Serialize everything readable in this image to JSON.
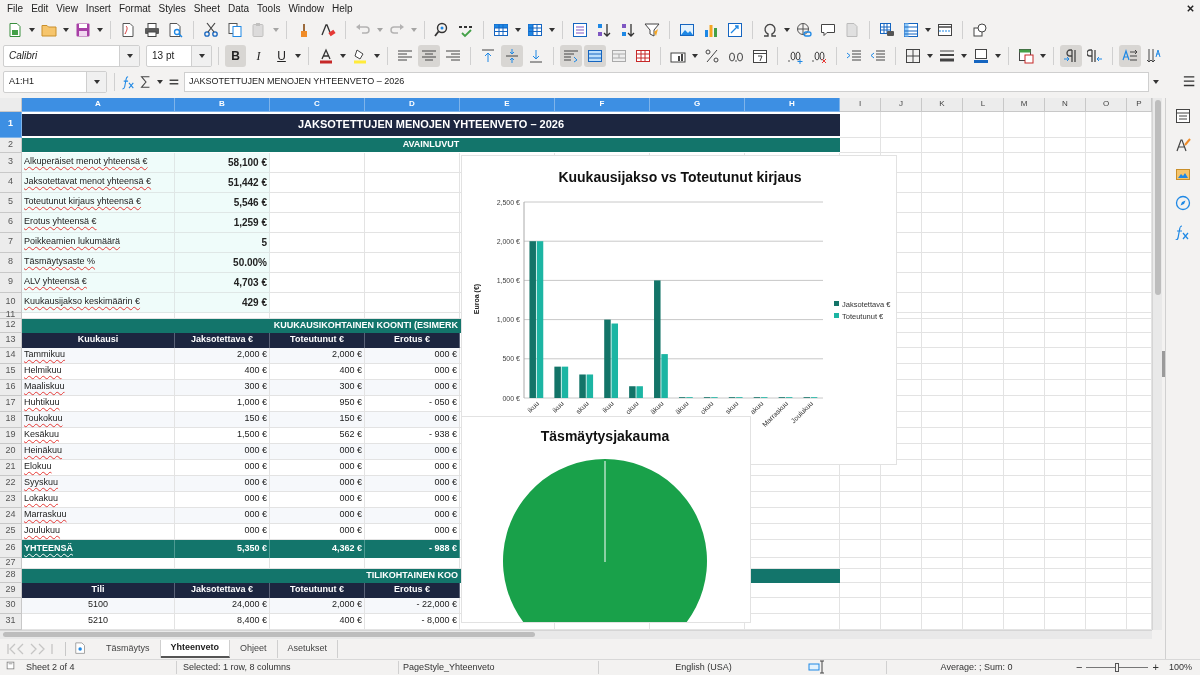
{
  "menu_bar": [
    "File",
    "Edit",
    "View",
    "Insert",
    "Format",
    "Styles",
    "Sheet",
    "Data",
    "Tools",
    "Window",
    "Help"
  ],
  "standard_toolbar": {
    "paste": {
      "disabled": true
    },
    "undo": {
      "disabled": true
    },
    "redo": {
      "disabled": true
    }
  },
  "format_toolbar": {
    "font_name": "Calibri",
    "font_size": "13 pt",
    "toggles": [
      {
        "kind": "bold",
        "label": "B",
        "on": true
      },
      {
        "kind": "italic",
        "label": "I",
        "on": false
      },
      {
        "kind": "underline",
        "label": "U",
        "on": false
      }
    ],
    "horizontal_align": [
      {
        "kind": "left",
        "selected": false
      },
      {
        "kind": "center",
        "selected": true
      },
      {
        "kind": "right",
        "selected": false
      }
    ],
    "vertical_align": [
      {
        "kind": "top",
        "selected": false
      },
      {
        "kind": "center",
        "selected": true
      },
      {
        "kind": "bottom",
        "selected": false
      }
    ],
    "wrap_text": {
      "on": true
    },
    "merge_and_center": {
      "on": true
    },
    "paragraph_direction": [
      {
        "kind": "ltr",
        "selected": true
      },
      {
        "kind": "rtl",
        "selected": false
      }
    ],
    "text_direction": [
      {
        "kind": "horizontal",
        "selected": true
      },
      {
        "kind": "vertical",
        "selected": false
      }
    ]
  },
  "formula_bar": {
    "name_box": "A1:H1",
    "content": "JAKSOTETTUJEN MENOJEN YHTEENVETO – 2026"
  },
  "columns": [
    {
      "label": "A",
      "selected": true
    },
    {
      "label": "B",
      "selected": true
    },
    {
      "label": "C",
      "selected": true
    },
    {
      "label": "D",
      "selected": true
    },
    {
      "label": "E",
      "selected": true
    },
    {
      "label": "F",
      "selected": true
    },
    {
      "label": "G",
      "selected": true
    },
    {
      "label": "H",
      "selected": true
    },
    {
      "label": "I",
      "selected": false
    },
    {
      "label": "J",
      "selected": false
    },
    {
      "label": "K",
      "selected": false
    },
    {
      "label": "L",
      "selected": false
    },
    {
      "label": "M",
      "selected": false
    },
    {
      "label": "N",
      "selected": false
    },
    {
      "label": "O",
      "selected": false
    },
    {
      "label": "P",
      "selected": false
    }
  ],
  "rows": [
    {
      "label": "1",
      "selected": true
    },
    {
      "label": "2",
      "selected": false
    },
    {
      "label": "3",
      "selected": false
    },
    {
      "label": "4",
      "selected": false
    },
    {
      "label": "5",
      "selected": false
    },
    {
      "label": "6",
      "selected": false
    },
    {
      "label": "7",
      "selected": false
    },
    {
      "label": "8",
      "selected": false
    },
    {
      "label": "9",
      "selected": false
    },
    {
      "label": "10",
      "selected": false
    },
    {
      "label": "11",
      "selected": false
    },
    {
      "label": "12",
      "selected": false
    },
    {
      "label": "13",
      "selected": false
    },
    {
      "label": "14",
      "selected": false
    },
    {
      "label": "15",
      "selected": false
    },
    {
      "label": "16",
      "selected": false
    },
    {
      "label": "17",
      "selected": false
    },
    {
      "label": "18",
      "selected": false
    },
    {
      "label": "19",
      "selected": false
    },
    {
      "label": "20",
      "selected": false
    },
    {
      "label": "21",
      "selected": false
    },
    {
      "label": "22",
      "selected": false
    },
    {
      "label": "23",
      "selected": false
    },
    {
      "label": "24",
      "selected": false
    },
    {
      "label": "25",
      "selected": false
    },
    {
      "label": "26",
      "selected": false
    },
    {
      "label": "27",
      "selected": false
    },
    {
      "label": "28",
      "selected": false
    },
    {
      "label": "29",
      "selected": false
    },
    {
      "label": "30",
      "selected": false
    },
    {
      "label": "31",
      "selected": false
    }
  ],
  "sheet": {
    "title": "JAKSOTETTUJEN MENOJEN YHTEENVETO – 2026",
    "key_figures_heading": "AVAINLUVUT",
    "key_figures": [
      {
        "label": "Alkuperäiset menot yhteensä €",
        "value": "58,100 €"
      },
      {
        "label": "Jaksotettavat menot yhteensä €",
        "value": "51,442 €"
      },
      {
        "label": "Toteutunut kirjaus yhteensä €",
        "value": "5,546 €"
      },
      {
        "label": "Erotus yhteensä €",
        "value": "1,259 €"
      },
      {
        "label": "Poikkeamien lukumäärä",
        "value": "5"
      },
      {
        "label": "Täsmäytysaste %",
        "value": "50.00%"
      },
      {
        "label": "ALV yhteensä €",
        "value": "4,703 €"
      },
      {
        "label": "Kuukausijakso keskimäärin €",
        "value": "429 €"
      }
    ],
    "monthly_heading": "KUUKAUSIKOHTAINEN KOONTI (ESIMERK",
    "monthly_columns": [
      "Kuukausi",
      "Jaksotettava €",
      "Toteutunut €",
      "Erotus €"
    ],
    "monthly_rows": [
      [
        "Tammikuu",
        "2,000 €",
        "2,000 €",
        "000 €"
      ],
      [
        "Helmikuu",
        "400 €",
        "400 €",
        "000 €"
      ],
      [
        "Maaliskuu",
        "300 €",
        "300 €",
        "000 €"
      ],
      [
        "Huhtikuu",
        "1,000 €",
        "950 €",
        "- 050 €"
      ],
      [
        "Toukokuu",
        "150 €",
        "150 €",
        "000 €"
      ],
      [
        "Kesäkuu",
        "1,500 €",
        "562 €",
        "- 938 €"
      ],
      [
        "Heinäkuu",
        "000 €",
        "000 €",
        "000 €"
      ],
      [
        "Elokuu",
        "000 €",
        "000 €",
        "000 €"
      ],
      [
        "Syyskuu",
        "000 €",
        "000 €",
        "000 €"
      ],
      [
        "Lokakuu",
        "000 €",
        "000 €",
        "000 €"
      ],
      [
        "Marraskuu",
        "000 €",
        "000 €",
        "000 €"
      ],
      [
        "Joulukuu",
        "000 €",
        "000 €",
        "000 €"
      ]
    ],
    "monthly_total": [
      "YHTEENSÄ",
      "5,350 €",
      "4,362 €",
      "- 988 €"
    ],
    "account_heading": "TILIKOHTAINEN KOO",
    "account_columns": [
      "Tili",
      "Jaksotettava €",
      "Toteutunut €",
      "Erotus €"
    ],
    "account_rows": [
      [
        "5100",
        "24,000 €",
        "2,000 €",
        "- 22,000 €"
      ],
      [
        "5210",
        "8,400 €",
        "400 €",
        "- 8,000 €"
      ]
    ]
  },
  "bar_chart": {
    "chart_data": {
      "type": "bar",
      "title": "Kuukausijakso vs Toteutunut kirjaus",
      "ylabel": "Euroa (€)",
      "categories": [
        "ikuu",
        "ikuu",
        "skuu",
        "ikuu",
        "okuu",
        "äkuu",
        "äkuu",
        "okuu",
        "skuu",
        "akuu",
        "Marraskuu",
        "Joulukuu"
      ],
      "series": [
        {
          "name": "Jaksotettava €",
          "color": "#137468",
          "values": [
            2000,
            400,
            300,
            1000,
            150,
            1500,
            0,
            0,
            0,
            0,
            0,
            0
          ]
        },
        {
          "name": "Toteutunut €",
          "color": "#1cb5a3",
          "values": [
            2000,
            400,
            300,
            950,
            150,
            560,
            0,
            0,
            0,
            0,
            0,
            0
          ]
        }
      ],
      "grid": true,
      "legend": true,
      "ylim": [
        0,
        2500
      ],
      "yticks": [
        {
          "value": 0,
          "label": "000 €"
        },
        {
          "value": 500,
          "label": "500 €"
        },
        {
          "value": 1000,
          "label": "1,000 €"
        },
        {
          "value": 1500,
          "label": "1,500 €"
        },
        {
          "value": 2000,
          "label": "2,000 €"
        },
        {
          "value": 2500,
          "label": "2,500 €"
        }
      ]
    }
  },
  "pie_chart": {
    "title": "Täsmäytysjakauma"
  },
  "sheet_navigation": {
    "disabled": true
  },
  "sheet_tabs": [
    {
      "label": "Täsmäytys",
      "selected": false
    },
    {
      "label": "Yhteenveto",
      "selected": true
    },
    {
      "label": "Ohjeet",
      "selected": false
    },
    {
      "label": "Asetukset",
      "selected": false
    }
  ],
  "status_bar": {
    "sheet": "Sheet 2 of 4",
    "selection": "Selected: 1 row, 8 columns",
    "page_style": "PageStyle_Yhteenveto",
    "language": "English (USA)",
    "summary": "Average: ; Sum: 0",
    "zoom_out": "−",
    "zoom_in": "+",
    "zoom_slider": {
      "level": 0.5
    },
    "zoom": "100%"
  }
}
